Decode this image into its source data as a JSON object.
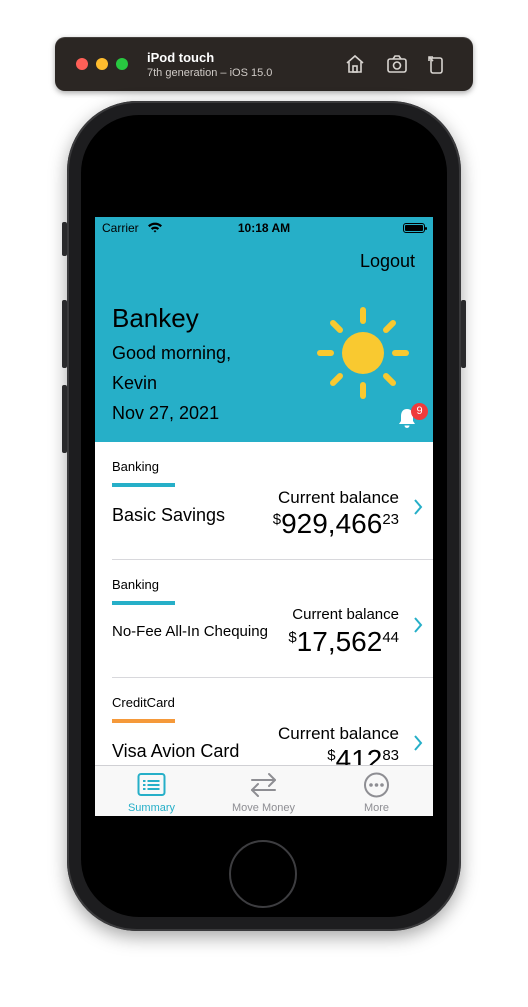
{
  "simulator": {
    "device_name": "iPod touch",
    "device_sub": "7th generation – iOS 15.0"
  },
  "status_bar": {
    "carrier": "Carrier",
    "time": "10:18 AM"
  },
  "header": {
    "logout_label": "Logout",
    "app_name": "Bankey",
    "greeting": "Good morning,",
    "user_name": "Kevin",
    "date": "Nov 27, 2021",
    "notification_count": "9",
    "sun_icon": "sun-icon",
    "bell_icon": "bell-icon",
    "background_color": "#26afc8"
  },
  "accounts": [
    {
      "type": "Banking",
      "type_color": "#26afc8",
      "name": "Basic Savings",
      "balance_label": "Current balance",
      "currency": "$",
      "dollars": "929,466",
      "cents": "23"
    },
    {
      "type": "Banking",
      "type_color": "#26afc8",
      "name": "No-Fee All-In Chequing",
      "balance_label": "Current balance",
      "currency": "$",
      "dollars": "17,562",
      "cents": "44"
    },
    {
      "type": "CreditCard",
      "type_color": "#f5993a",
      "name": "Visa Avion Card",
      "balance_label": "Current balance",
      "currency": "$",
      "dollars": "412",
      "cents": "83"
    }
  ],
  "tab_bar": {
    "tabs": [
      {
        "label": "Summary",
        "icon": "summary-list-icon",
        "selected": true
      },
      {
        "label": "Move Money",
        "icon": "transfer-arrows-icon",
        "selected": false
      },
      {
        "label": "More",
        "icon": "ellipsis-circle-icon",
        "selected": false
      }
    ],
    "active_color": "#26afc8",
    "inactive_color": "#8e8e93"
  }
}
